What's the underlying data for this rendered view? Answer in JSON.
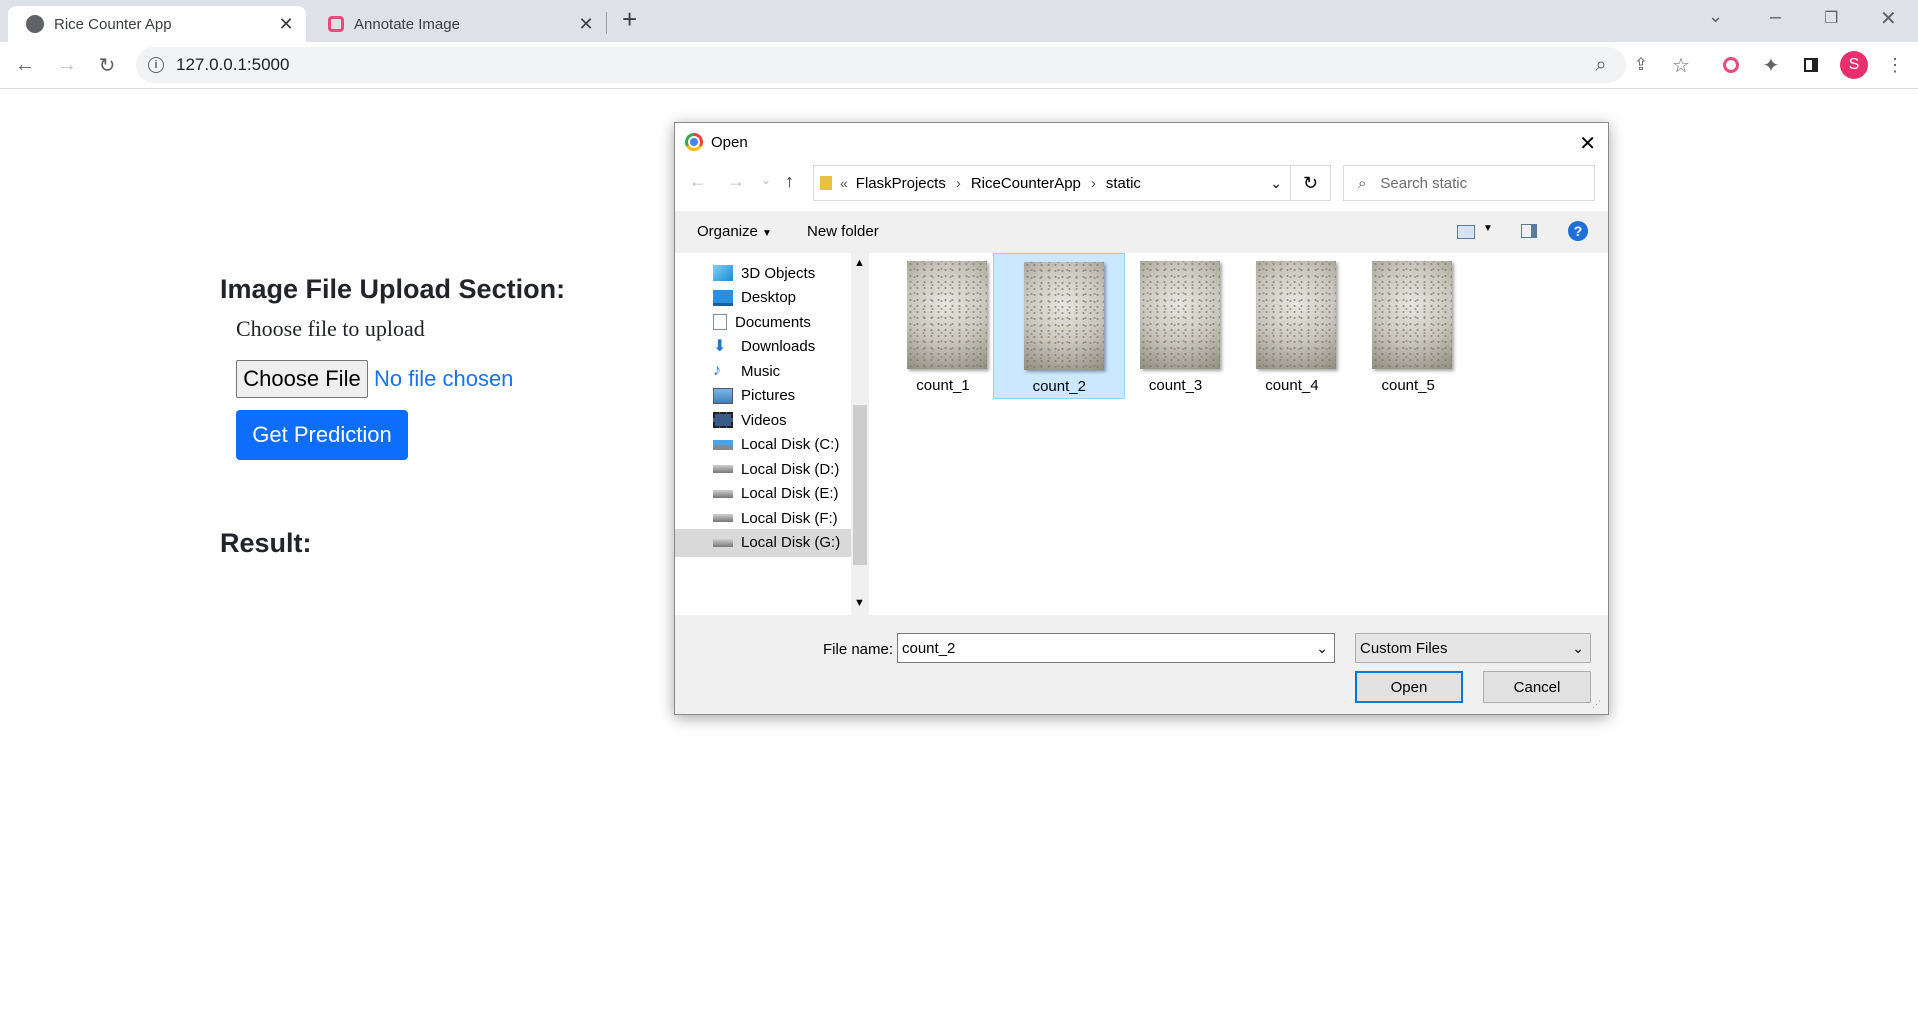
{
  "browser": {
    "tabs": [
      {
        "title": "Rice Counter App",
        "active": true
      },
      {
        "title": "Annotate Image",
        "active": false
      }
    ],
    "url": "127.0.0.1:5000",
    "profile_initial": "S"
  },
  "page": {
    "upload_heading": "Image File Upload Section:",
    "choose_label": "Choose file to upload",
    "file_button_label": "Choose File",
    "file_status": "No file chosen",
    "predict_button_label": "Get Prediction",
    "result_heading": "Result:"
  },
  "dialog": {
    "title": "Open",
    "breadcrumb": [
      "FlaskProjects",
      "RiceCounterApp",
      "static"
    ],
    "search_placeholder": "Search static",
    "organize_label": "Organize",
    "new_folder_label": "New folder",
    "nav_items": [
      {
        "label": "3D Objects",
        "icon": "cube-icon"
      },
      {
        "label": "Desktop",
        "icon": "desktop-icon"
      },
      {
        "label": "Documents",
        "icon": "document-icon"
      },
      {
        "label": "Downloads",
        "icon": "download-arrow-icon"
      },
      {
        "label": "Music",
        "icon": "music-note-icon"
      },
      {
        "label": "Pictures",
        "icon": "picture-icon"
      },
      {
        "label": "Videos",
        "icon": "film-icon"
      },
      {
        "label": "Local Disk (C:)",
        "icon": "windows-drive-icon"
      },
      {
        "label": "Local Disk (D:)",
        "icon": "drive-icon"
      },
      {
        "label": "Local Disk (E:)",
        "icon": "drive-icon"
      },
      {
        "label": "Local Disk (F:)",
        "icon": "drive-icon"
      },
      {
        "label": "Local Disk (G:)",
        "icon": "drive-icon",
        "selected": true
      }
    ],
    "files": [
      {
        "name": "count_1",
        "selected": false
      },
      {
        "name": "count_2",
        "selected": true
      },
      {
        "name": "count_3",
        "selected": false
      },
      {
        "name": "count_4",
        "selected": false
      },
      {
        "name": "count_5",
        "selected": false
      }
    ],
    "file_name_label": "File name:",
    "file_name_value": "count_2",
    "file_type": "Custom Files",
    "open_label": "Open",
    "cancel_label": "Cancel"
  }
}
